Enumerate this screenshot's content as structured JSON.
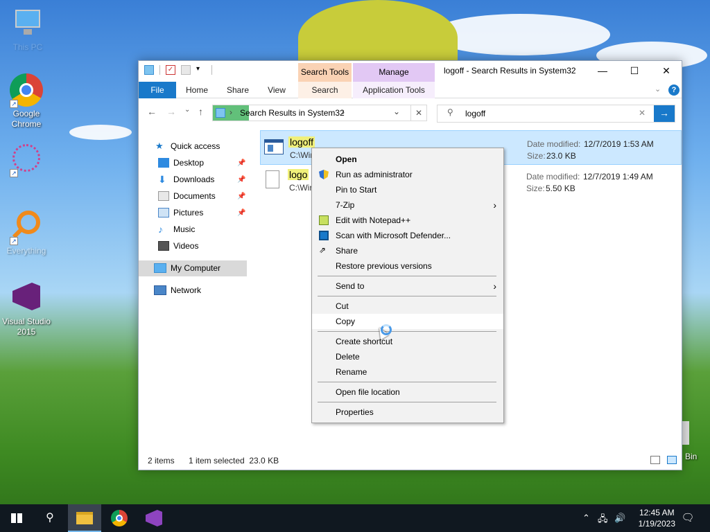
{
  "desktop": {
    "icons": [
      {
        "label": "This PC"
      },
      {
        "label": "Google Chrome"
      },
      {
        "label": ""
      },
      {
        "label": "Everything"
      },
      {
        "label": "Visual Studio 2015"
      },
      {
        "label": "Bin"
      }
    ]
  },
  "window": {
    "title": "logoff - Search Results in System32",
    "context_tabs": {
      "search_tools": "Search Tools",
      "manage": "Manage"
    },
    "ribbon_tabs": [
      "File",
      "Home",
      "Share",
      "View",
      "Search",
      "Application Tools"
    ],
    "address": {
      "segment": "Search Results in System32"
    },
    "search": {
      "value": "logoff"
    },
    "nav": {
      "quick_access": "Quick access",
      "items": [
        "Desktop",
        "Downloads",
        "Documents",
        "Pictures",
        "Music",
        "Videos"
      ],
      "my_computer": "My Computer",
      "network": "Network"
    },
    "files": [
      {
        "name": "logoff",
        "path": "C:\\Wir",
        "date_label": "Date modified:",
        "date": "12/7/2019 1:53 AM",
        "size_label": "Size:",
        "size": "23.0 KB"
      },
      {
        "name": "logo",
        "path": "C:\\Wir",
        "date_label": "Date modified:",
        "date": "12/7/2019 1:49 AM",
        "size_label": "Size:",
        "size": "5.50 KB"
      }
    ],
    "status": {
      "count": "2 items",
      "selection": "1 item selected  23.0 KB"
    }
  },
  "context_menu": {
    "items": {
      "open": "Open",
      "run_admin": "Run as administrator",
      "pin_start": "Pin to Start",
      "zip": "7-Zip",
      "notepad": "Edit with Notepad++",
      "defender": "Scan with Microsoft Defender...",
      "share": "Share",
      "restore": "Restore previous versions",
      "send_to": "Send to",
      "cut": "Cut",
      "copy": "Copy",
      "shortcut": "Create shortcut",
      "delete": "Delete",
      "rename": "Rename",
      "open_location": "Open file location",
      "properties": "Properties"
    }
  },
  "taskbar": {
    "time": "12:45 AM",
    "date": "1/19/2023"
  },
  "colors": {
    "accent": "#1979ca",
    "selection": "#cce8ff",
    "search_highlight": "#f0f07a",
    "taskbar": "#101820"
  }
}
